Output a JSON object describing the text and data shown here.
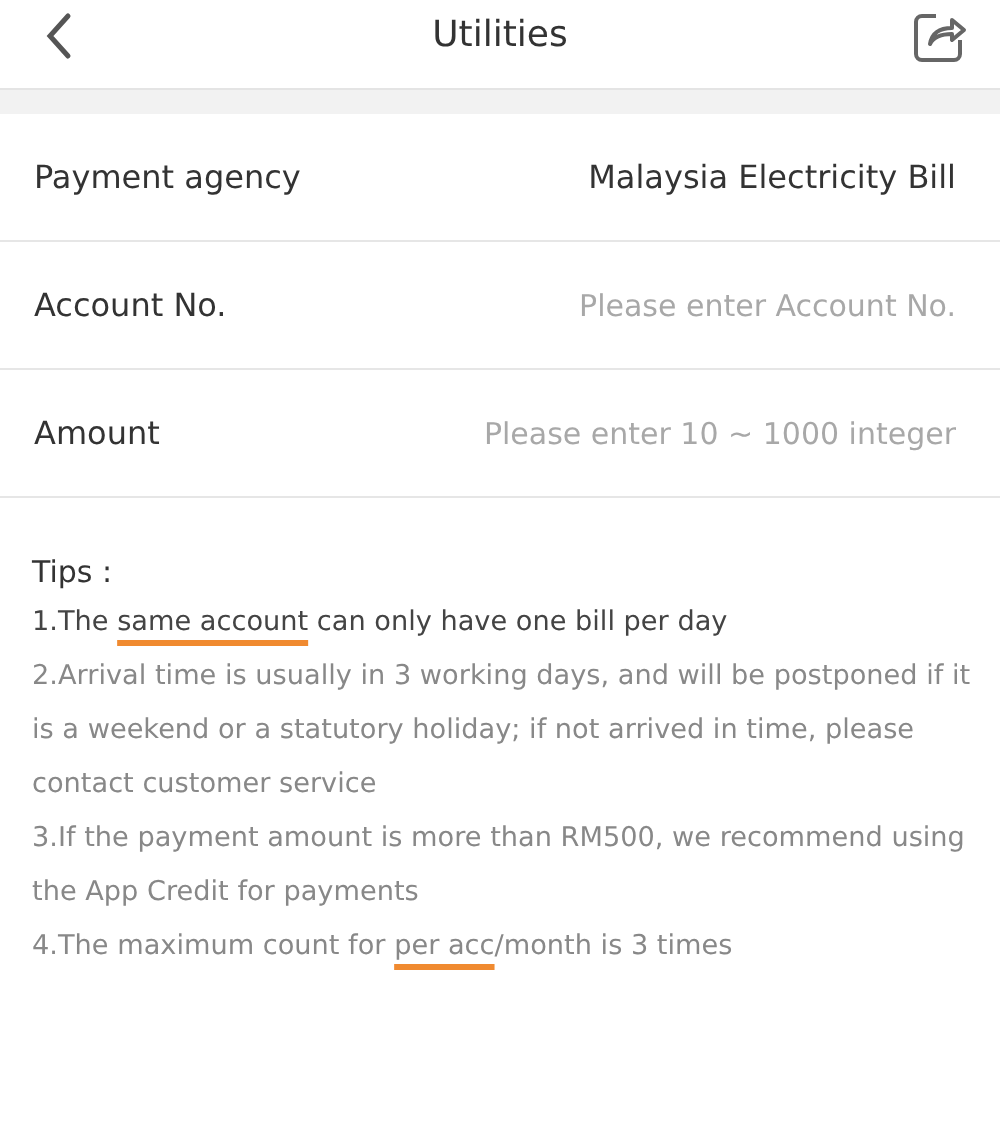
{
  "header": {
    "title": "Utilities"
  },
  "form_rows": [
    {
      "label": "Payment agency",
      "value": "Malaysia Electricity Bill"
    },
    {
      "label": "Account No.",
      "placeholder": "Please enter Account No."
    },
    {
      "label": "Amount",
      "placeholder": "Please enter 10 ~ 1000 integer"
    }
  ],
  "tips": {
    "title": "Tips :",
    "items": [
      {
        "strong": true,
        "parts": [
          {
            "text": "1.The "
          },
          {
            "text": "same account",
            "underlined": true
          },
          {
            "text": " can only have one bill per day"
          }
        ]
      },
      {
        "strong": false,
        "parts": [
          {
            "text": "2.Arrival time is usually in 3 working days, and will be postponed if it is a weekend or a statutory holiday; if not arrived in time, please contact customer service"
          }
        ]
      },
      {
        "strong": false,
        "parts": [
          {
            "text": "3.If the payment amount is more than RM500, we recommend using the App Credit for payments"
          }
        ]
      },
      {
        "strong": false,
        "parts": [
          {
            "text": "4.The maximum count for "
          },
          {
            "text": "per acc",
            "underlined": true
          },
          {
            "text": "/month is 3 times"
          }
        ]
      }
    ]
  }
}
